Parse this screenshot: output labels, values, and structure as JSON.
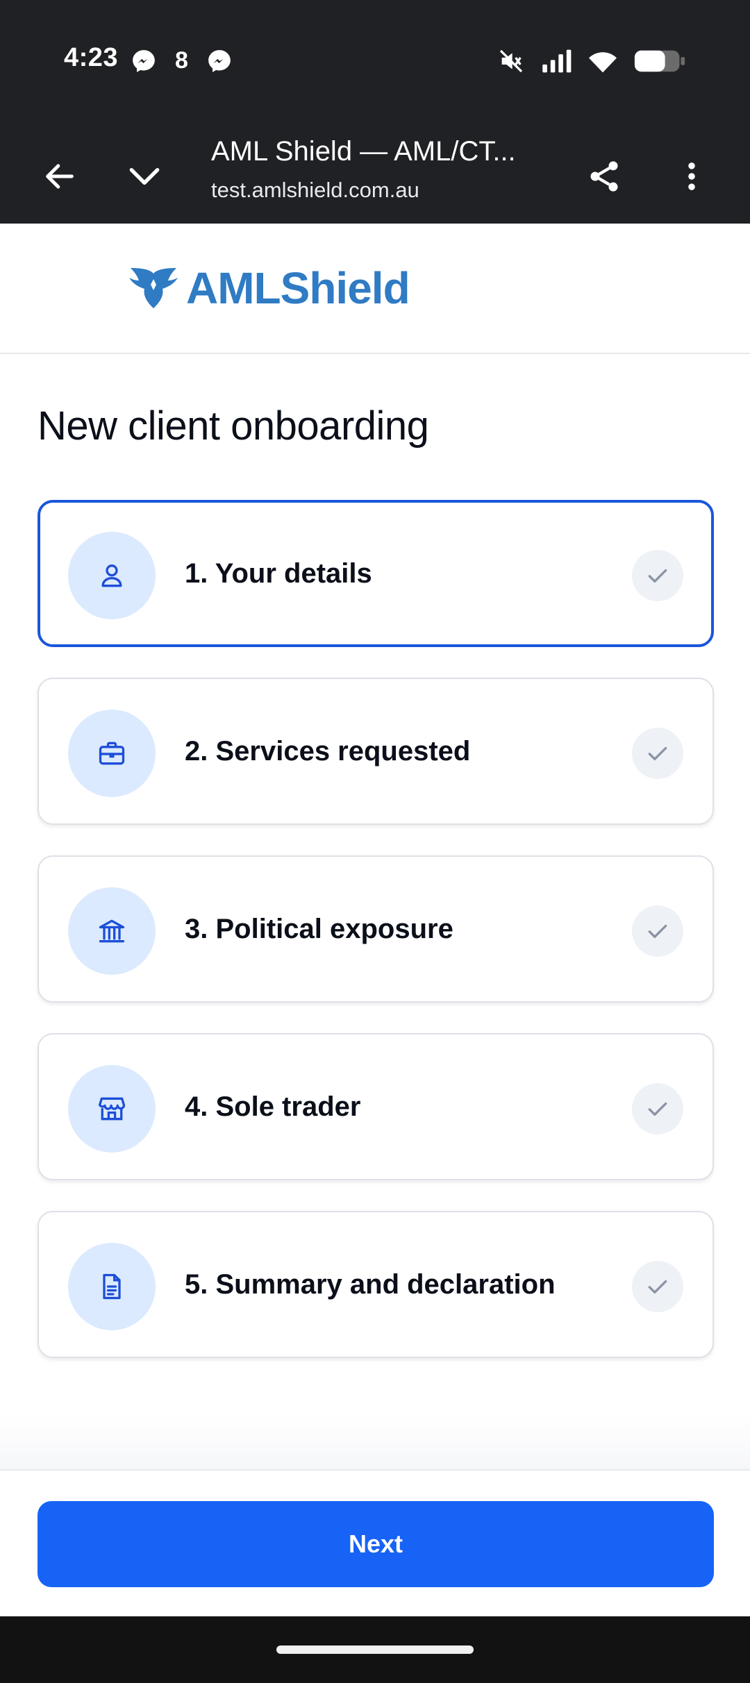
{
  "status_bar": {
    "time": "4:23",
    "left_icons": [
      "messenger-icon",
      "notification-8-icon",
      "messenger-icon"
    ],
    "badge_text": "8",
    "right_icons": [
      "mute-icon",
      "signal-icon",
      "wifi-icon",
      "battery-icon"
    ]
  },
  "browser": {
    "page_title": "AML Shield — AML/CT...",
    "domain": "test.amlshield.com.au",
    "icons": [
      "back-arrow-icon",
      "chevron-down-icon",
      "share-icon",
      "more-vert-icon"
    ]
  },
  "logo": {
    "text_bold": "AML",
    "text_regular": "Shield",
    "color": "#2f7bc4"
  },
  "main": {
    "title": "New client onboarding",
    "steps": [
      {
        "label": "1. Your details",
        "icon": "user-icon",
        "active": true
      },
      {
        "label": "2. Services requested",
        "icon": "briefcase-icon",
        "active": false
      },
      {
        "label": "3. Political exposure",
        "icon": "government-building-icon",
        "active": false
      },
      {
        "label": "4. Sole trader",
        "icon": "store-icon",
        "active": false
      },
      {
        "label": "5. Summary and declaration",
        "icon": "document-icon",
        "active": false
      }
    ]
  },
  "footer": {
    "next_label": "Next"
  },
  "colors": {
    "accent": "#1763f6",
    "active_border": "#1a56db",
    "icon_bg": "#dbeafe",
    "icon_fg": "#1d4ed8",
    "dark_bar": "#202124"
  }
}
